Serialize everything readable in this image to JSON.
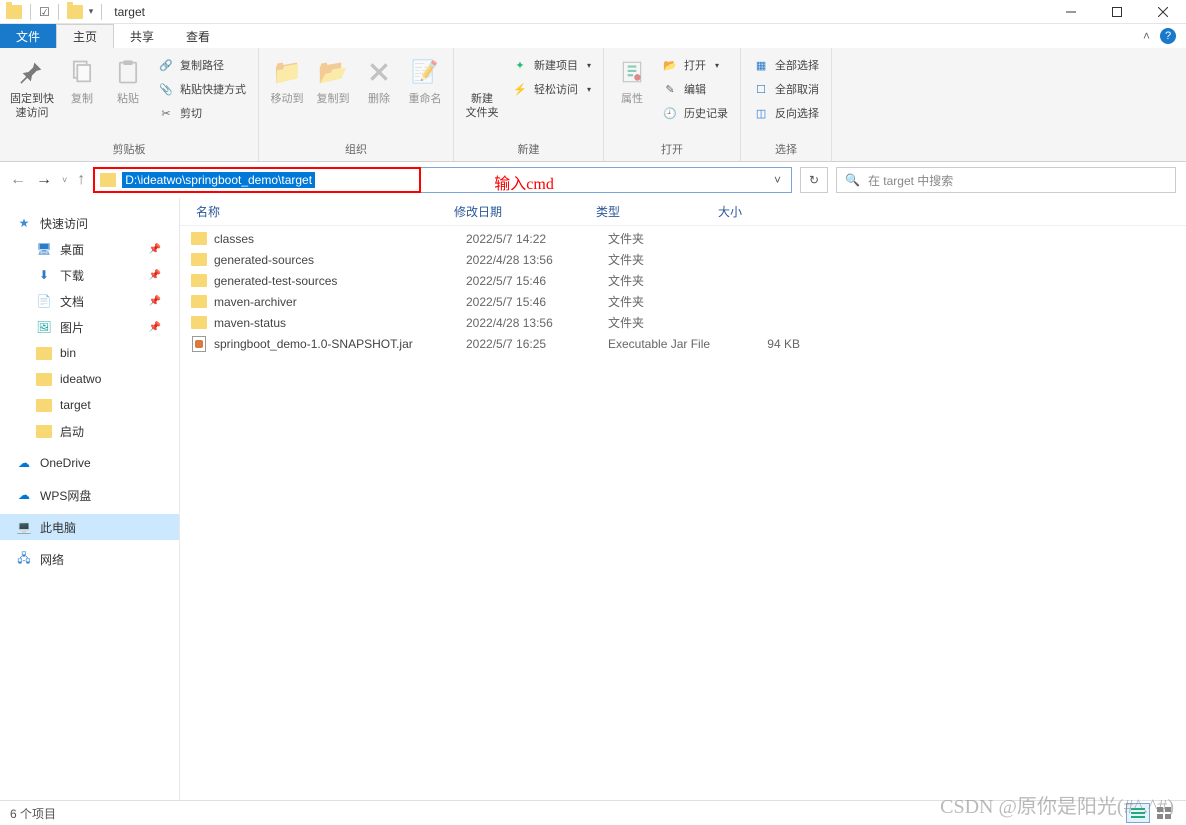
{
  "title": "target",
  "tabs": {
    "file": "文件",
    "home": "主页",
    "share": "共享",
    "view": "查看"
  },
  "ribbon": {
    "clipboard": {
      "pin": "固定到快\n速访问",
      "copy": "复制",
      "paste": "粘贴",
      "copy_path": "复制路径",
      "paste_shortcut": "粘贴快捷方式",
      "cut": "剪切",
      "label": "剪贴板"
    },
    "organize": {
      "move_to": "移动到",
      "copy_to": "复制到",
      "delete": "删除",
      "rename": "重命名",
      "label": "组织"
    },
    "new": {
      "new_folder": "新建\n文件夹",
      "new_item": "新建项目",
      "easy_access": "轻松访问",
      "label": "新建"
    },
    "open": {
      "properties": "属性",
      "open": "打开",
      "edit": "编辑",
      "history": "历史记录",
      "label": "打开"
    },
    "select": {
      "select_all": "全部选择",
      "select_none": "全部取消",
      "invert": "反向选择",
      "label": "选择"
    }
  },
  "address": {
    "path": "D:\\ideatwo\\springboot_demo\\target",
    "annotation": "输入cmd",
    "search_placeholder": "在 target 中搜索"
  },
  "sidebar": {
    "quick_access": "快速访问",
    "items": [
      {
        "label": "桌面",
        "icon": "desktop",
        "pinned": true
      },
      {
        "label": "下载",
        "icon": "download",
        "pinned": true
      },
      {
        "label": "文档",
        "icon": "document",
        "pinned": true
      },
      {
        "label": "图片",
        "icon": "picture",
        "pinned": true
      },
      {
        "label": "bin",
        "icon": "folder",
        "pinned": false
      },
      {
        "label": "ideatwo",
        "icon": "folder",
        "pinned": false
      },
      {
        "label": "target",
        "icon": "folder",
        "pinned": false
      },
      {
        "label": "启动",
        "icon": "folder",
        "pinned": false
      }
    ],
    "onedrive": "OneDrive",
    "wps": "WPS网盘",
    "this_pc": "此电脑",
    "network": "网络"
  },
  "columns": {
    "name": "名称",
    "date": "修改日期",
    "type": "类型",
    "size": "大小"
  },
  "files": [
    {
      "name": "classes",
      "date": "2022/5/7 14:22",
      "type": "文件夹",
      "size": "",
      "icon": "folder"
    },
    {
      "name": "generated-sources",
      "date": "2022/4/28 13:56",
      "type": "文件夹",
      "size": "",
      "icon": "folder"
    },
    {
      "name": "generated-test-sources",
      "date": "2022/5/7 15:46",
      "type": "文件夹",
      "size": "",
      "icon": "folder"
    },
    {
      "name": "maven-archiver",
      "date": "2022/5/7 15:46",
      "type": "文件夹",
      "size": "",
      "icon": "folder"
    },
    {
      "name": "maven-status",
      "date": "2022/4/28 13:56",
      "type": "文件夹",
      "size": "",
      "icon": "folder"
    },
    {
      "name": "springboot_demo-1.0-SNAPSHOT.jar",
      "date": "2022/5/7 16:25",
      "type": "Executable Jar File",
      "size": "94 KB",
      "icon": "jar"
    }
  ],
  "status": {
    "count": "6 个项目"
  },
  "watermark": "CSDN @原你是阳光(#^.^#)"
}
